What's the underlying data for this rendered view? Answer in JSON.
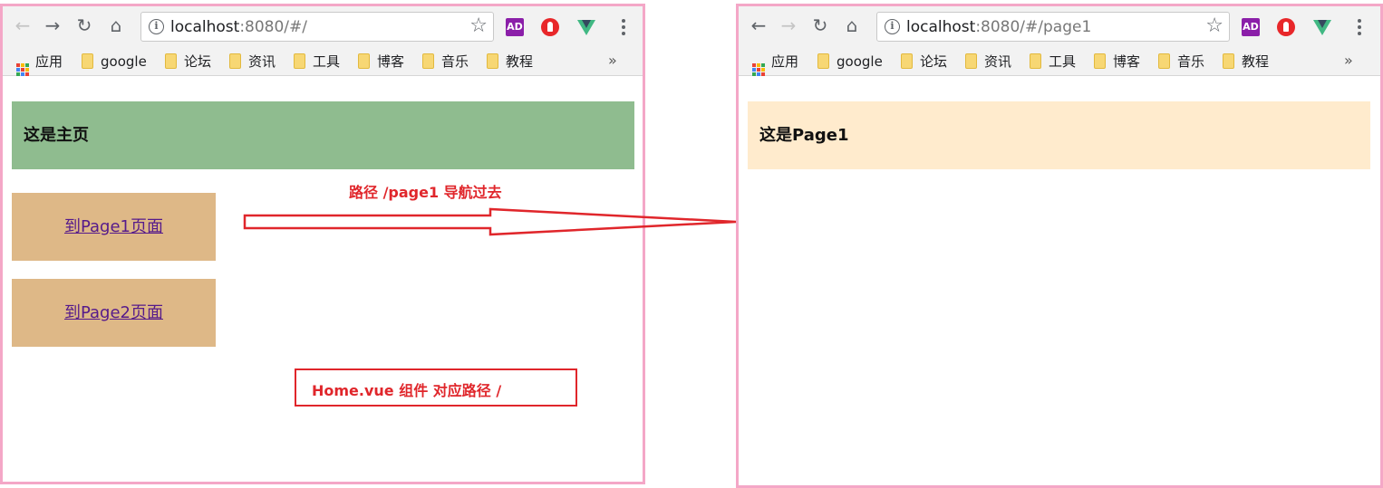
{
  "left_window": {
    "url_host": "localhost",
    "url_rest": ":8080/#/",
    "header_text": "这是主页",
    "header_color": "#8fbc8f",
    "links": [
      {
        "label": "到Page1页面"
      },
      {
        "label": "到Page2页面"
      }
    ]
  },
  "right_window": {
    "url_host": "localhost",
    "url_rest": ":8080/#/page1",
    "header_text": "这是Page1",
    "header_color": "#ffebcd"
  },
  "bookmarks": {
    "apps": "应用",
    "items": [
      "google",
      "论坛",
      "资讯",
      "工具",
      "博客",
      "音乐",
      "教程"
    ],
    "more": "»"
  },
  "extensions": {
    "ad_label": "AD"
  },
  "annotations": {
    "arrow_label": "路径  /page1  导航过去",
    "component_label": "Home.vue 组件 对应路径  /",
    "color": "#e0262b"
  }
}
